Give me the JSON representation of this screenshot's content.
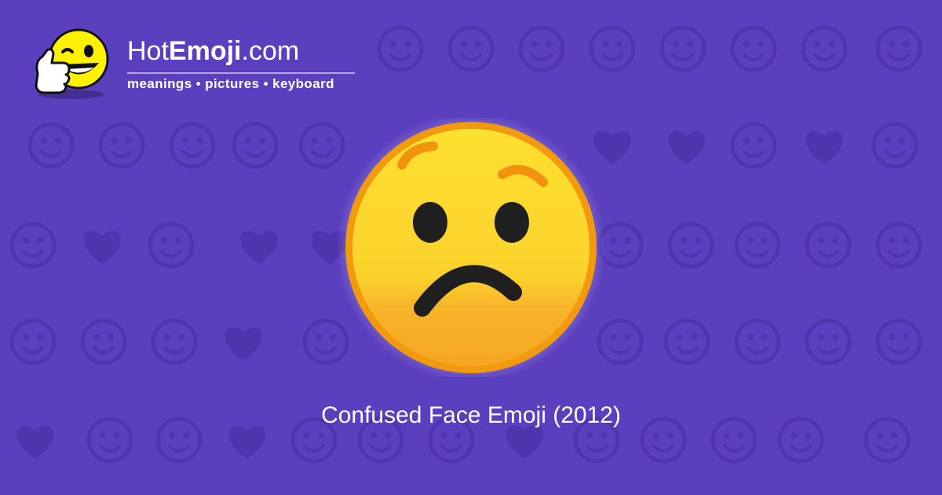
{
  "site": {
    "name_prefix": "Hot",
    "name_strong": "Emoji",
    "name_suffix": ".com",
    "tagline": "meanings • pictures • keyboard"
  },
  "emoji": {
    "caption": "Confused Face Emoji (2012)"
  },
  "colors": {
    "background": "#5a3fbf",
    "pattern_glyph": "#4f35ad",
    "emoji_top": "#fde030",
    "emoji_bottom": "#f5a623",
    "emoji_rim": "#f29a0e",
    "feature_dark": "#1f1f1f",
    "brow_orange": "#f09410"
  },
  "background_icons": [
    "heart-icon",
    "smile-icon",
    "wink-icon",
    "kiss-icon",
    "two-hearts-icon",
    "smile-icon",
    "weary-icon",
    "ok-hand-icon",
    "expressionless-icon",
    "eyes-icon",
    "smirk-icon",
    "relieved-icon",
    "grimace-icon",
    "recycle-icon",
    "raising-hands-icon",
    "music-notes-icon",
    "sleeping-icon",
    "disappointed-icon",
    "grin-icon",
    "sparkles-icon",
    "grin-icon",
    "striped-heart-icon",
    "broken-heart-icon",
    "confused-icon",
    "striped-heart-icon",
    "tongue-wink-icon",
    "frown-icon",
    "heart-arrow-icon",
    "tired-icon",
    "revolving-hearts-icon",
    "heart-icon",
    "monkey-icon",
    "scream-icon",
    "smiling-devil-icon",
    "angry-icon",
    "arrow-left-icon",
    "fire-icon",
    "party-popper-icon",
    "squint-tongue-icon",
    "rose-icon",
    "sun-icon",
    "flexed-biceps-icon",
    "striped-heart-icon",
    "check-mark-icon",
    "laughing-icon",
    "moon-face-icon",
    "heart-eyes-cat-icon",
    "waving-hand-icon",
    "mask-icon",
    "camera-icon",
    "cold-sweat-icon",
    "big-grin-icon",
    "vibrating-heart-icon",
    "relieved-icon",
    "kiss-icon"
  ]
}
